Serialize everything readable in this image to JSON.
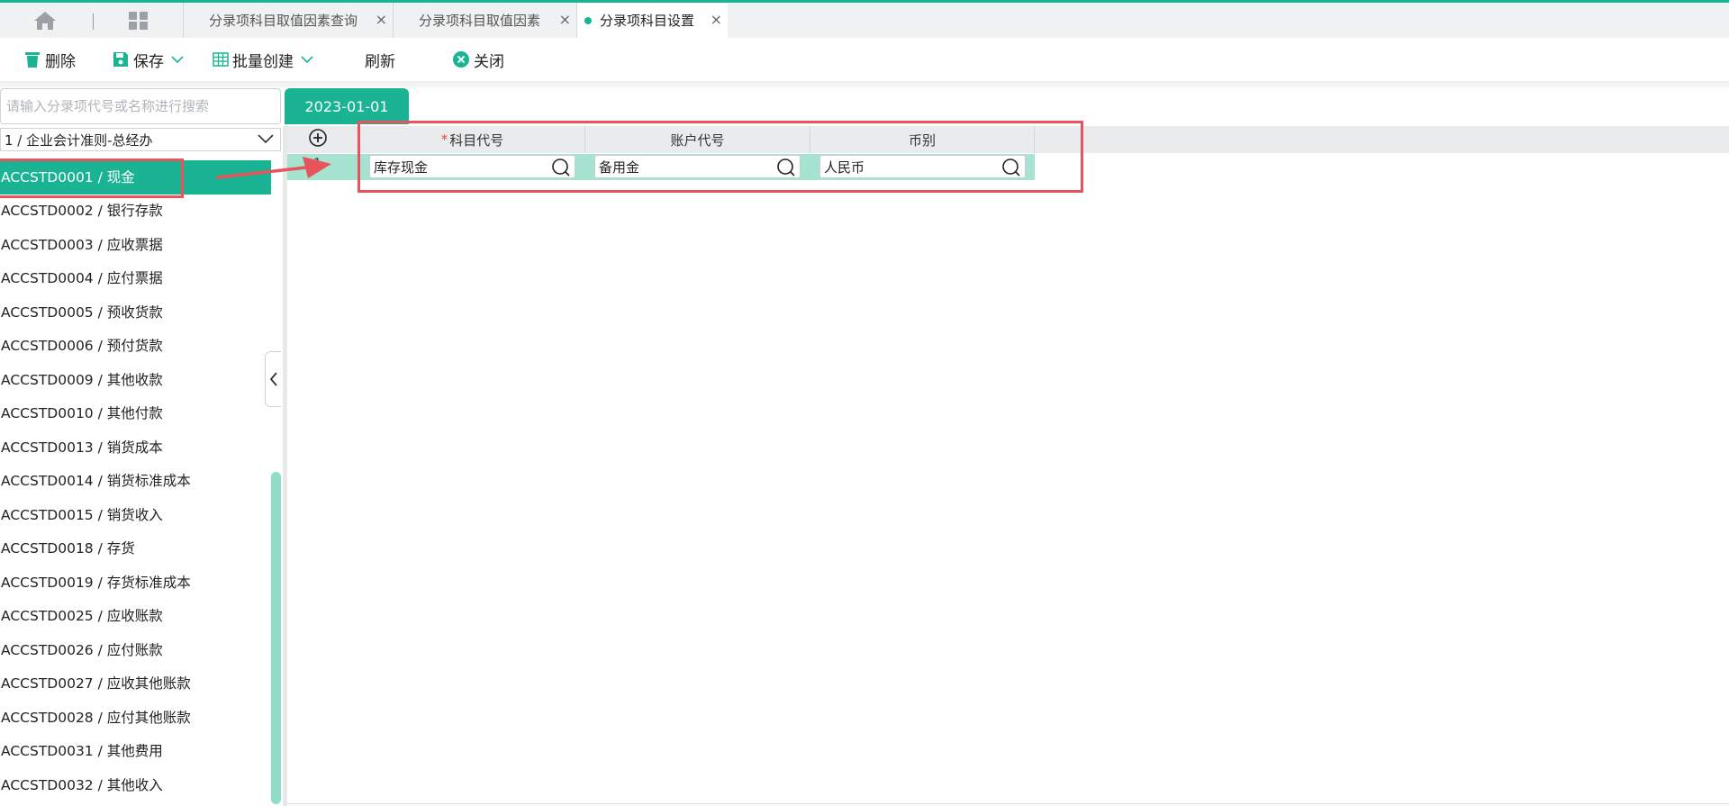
{
  "tabs": [
    {
      "label": "分录项科目取值因素查询",
      "close": "×"
    },
    {
      "label": "分录项科目取值因素",
      "close": "×"
    },
    {
      "label": "分录项科目设置",
      "close": "×"
    }
  ],
  "toolbar": {
    "delete": "删除",
    "save": "保存",
    "batch_create": "批量创建",
    "refresh": "刷新",
    "close": "关闭"
  },
  "left": {
    "search_placeholder": "请输入分录项代号或名称进行搜索",
    "selector_value": "1 / 企业会计准则-总经办",
    "items": [
      "ACCSTD0001 / 现金",
      "ACCSTD0002 / 银行存款",
      "ACCSTD0003 / 应收票据",
      "ACCSTD0004 / 应付票据",
      "ACCSTD0005 / 预收货款",
      "ACCSTD0006 / 预付货款",
      "ACCSTD0009 / 其他收款",
      "ACCSTD0010 / 其他付款",
      "ACCSTD0013 / 销货成本",
      "ACCSTD0014 / 销货标准成本",
      "ACCSTD0015 / 销货收入",
      "ACCSTD0018 / 存货",
      "ACCSTD0019 / 存货标准成本",
      "ACCSTD0025 / 应收账款",
      "ACCSTD0026 / 应付账款",
      "ACCSTD0027 / 应收其他账款",
      "ACCSTD0028 / 应付其他账款",
      "ACCSTD0031 / 其他费用",
      "ACCSTD0032 / 其他收入"
    ]
  },
  "right": {
    "date_tab": "2023-01-01",
    "columns": {
      "required_mark": "*",
      "subject_code": "科目代号",
      "account_code": "账户代号",
      "currency": "币别"
    },
    "row": {
      "number": "1",
      "subject_code": "库存现金",
      "account_code": "备用金",
      "currency": "人民币"
    }
  },
  "colors": {
    "accent": "#1ab394",
    "annotation_red": "#e9535c"
  }
}
